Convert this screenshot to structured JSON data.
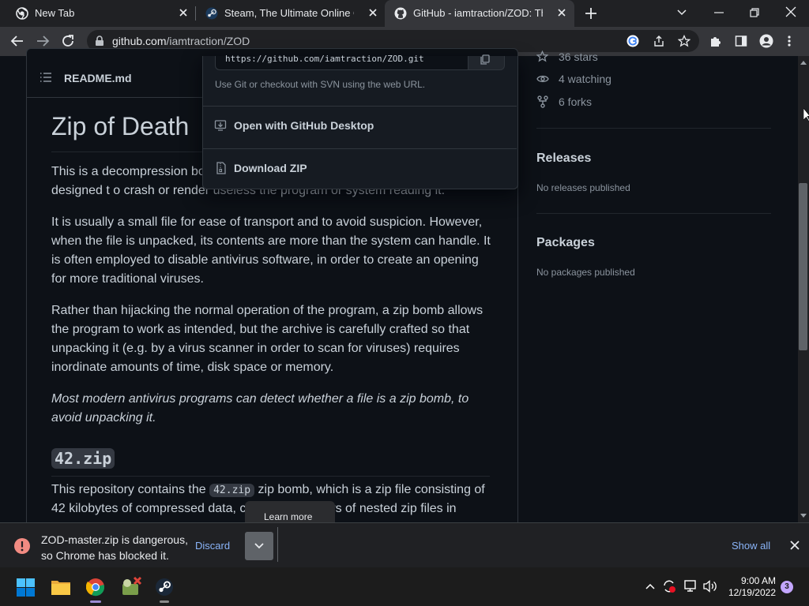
{
  "browser": {
    "tabs": [
      {
        "title": "New Tab"
      },
      {
        "title": "Steam, The Ultimate Online Game"
      },
      {
        "title": "GitHub - iamtraction/ZOD: This is"
      }
    ],
    "url_host": "github.com",
    "url_path": "/iamtraction/ZOD"
  },
  "readme": {
    "header_title": "README.md",
    "h1": "Zip of Death",
    "p1_line1_start": "This is a decompression bo",
    "p1_line2": "designed t o crash or render useless the program or system reading it.",
    "p2": "It is usually a small file for ease of transport and to avoid suspicion. However, when the file is unpacked, its contents are more than the system can handle. It is often employed to disable antivirus software, in order to create an opening for more traditional viruses.",
    "p3": "Rather than hijacking the normal operation of the program, a zip bomb allows the program to work as intended, but the archive is carefully crafted so that unpacking it (e.g. by a virus scanner in order to scan for viruses) requires inordinate amounts of time, disk space or memory.",
    "p4": "Most modern antivirus programs can detect whether a file is a zip bomb, to avoid unpacking it.",
    "h2": "42.zip",
    "p5_a": "This repository contains the ",
    "p5_code": "42.zip",
    "p5_b": " zip bomb, which is a zip file consisting of",
    "p5_line2_a": "42 kilobytes of compressed data, c",
    "p5_line2_b": "yers of nested zip files in"
  },
  "sidebar": {
    "stars": "36 stars",
    "watching": "4 watching",
    "forks": "6 forks",
    "releases_title": "Releases",
    "releases_empty": "No releases published",
    "packages_title": "Packages",
    "packages_empty": "No packages published"
  },
  "clone_menu": {
    "url": "https://github.com/iamtraction/ZOD.git",
    "hint": "Use Git or checkout with SVN using the web URL.",
    "open_desktop": "Open with GitHub Desktop",
    "download_zip": "Download ZIP"
  },
  "tooltip": "Learn more",
  "download_bar": {
    "message_line1": "ZOD-master.zip is dangerous,",
    "message_line2": "so Chrome has blocked it.",
    "discard": "Discard",
    "show_all": "Show all"
  },
  "taskbar": {
    "time": "9:00 AM",
    "date": "12/19/2022",
    "notification_count": "3"
  },
  "colors": {
    "page_bg": "#0d1117",
    "link": "#8ab4f8",
    "danger": "#f28b82"
  }
}
